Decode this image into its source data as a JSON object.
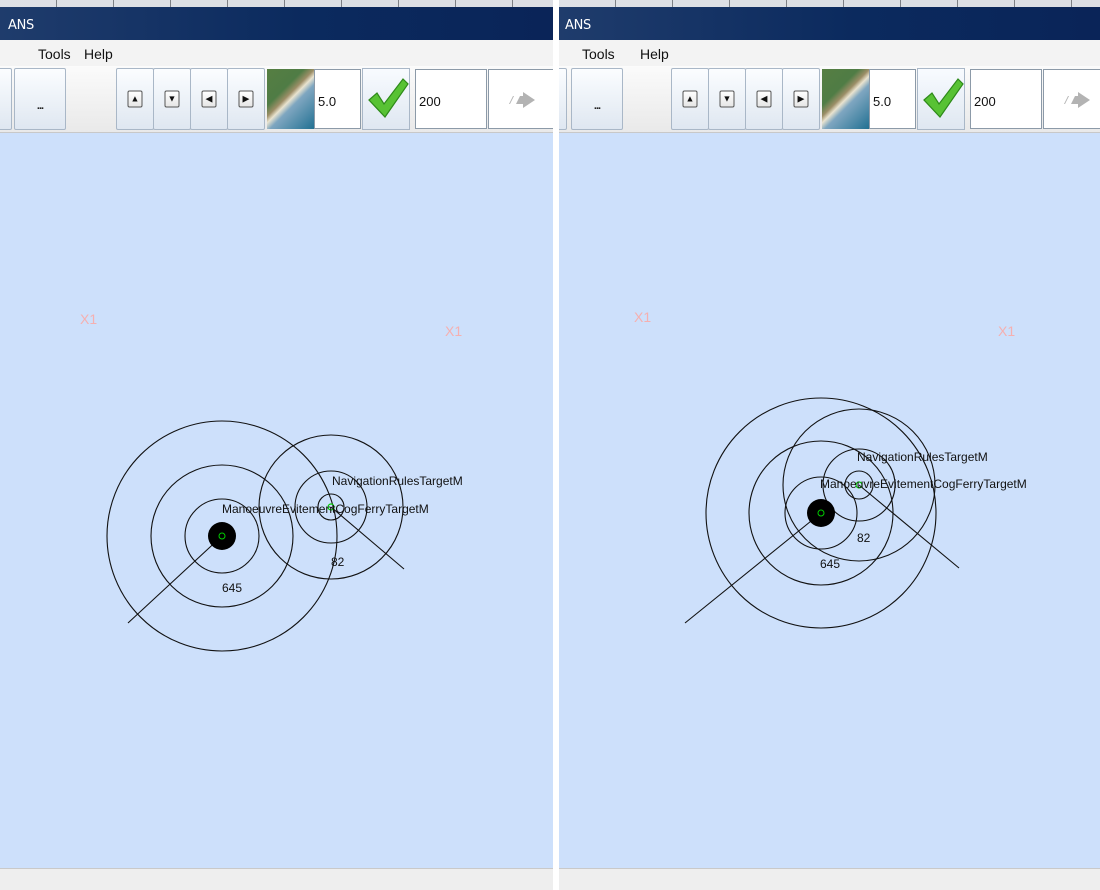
{
  "window": {
    "title": "ANS"
  },
  "menu": {
    "tools": "Tools",
    "help": "Help"
  },
  "toolbar": {
    "more_button": "...",
    "zoom_value": "5.0",
    "range_value": "200",
    "icons": {
      "up": "arrow-up-icon",
      "down": "arrow-down-icon",
      "left": "arrow-left-icon",
      "right": "arrow-right-icon",
      "apply": "checkmark-icon",
      "go": "forward-arrows-icon"
    }
  },
  "panels": [
    {
      "id": "left",
      "labels": {
        "target_a": "NavigationRulesTargetM",
        "target_b": "ManoeuvreEvitementCogFerryTargetM",
        "own_ship_number": "645",
        "target_number": "82"
      },
      "markers": [
        "X1",
        "X1"
      ]
    },
    {
      "id": "right",
      "labels": {
        "target_a": "NavigationRulesTargetM",
        "target_b": "ManoeuvreEvitementCogFerryTargetM",
        "own_ship_number": "645",
        "target_number": "82"
      },
      "markers": [
        "X1",
        "X1"
      ]
    }
  ],
  "colors": {
    "sea": "#cde0fb",
    "title_bar": "#0b2a5e",
    "ship": "#000000",
    "target_marker": "#00cc00",
    "waypoint": "#f5b0b0"
  }
}
